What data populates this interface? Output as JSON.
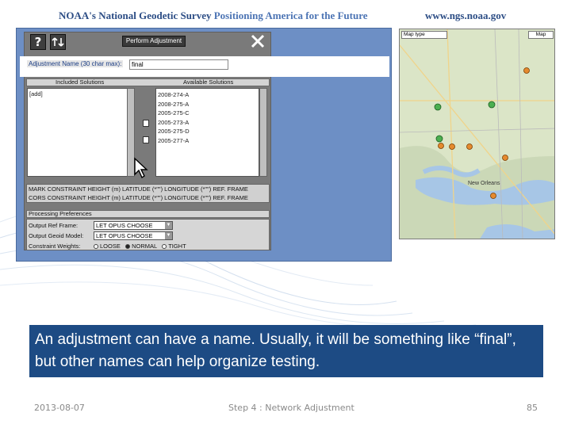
{
  "header": {
    "org_left": "NOAA's",
    "org_name": "National Geodetic Survey",
    "tagline": "Positioning America for the Future",
    "url": "www.ngs.noaa.gov"
  },
  "toolbar": {
    "help_icon": "?",
    "perform_label": "Perform Adjustment"
  },
  "adjustment_name": {
    "label": "Adjustment Name (30 char max):",
    "value": "final"
  },
  "solutions": {
    "included_header": "Included Solutions",
    "available_header": "Available Solutions",
    "included": [
      "[add]"
    ],
    "available": [
      "2008-274-A",
      "2008-275-A",
      "2005-275-C",
      "2005-273-A",
      "2005-275-D",
      "2005-277-A"
    ]
  },
  "constraints": {
    "row1": "MARK  CONSTRAINT  HEIGHT (m)  LATITUDE (*\"\")  LONGITUDE (*\"\")  REF. FRAME",
    "row2": "CORS  CONSTRAINT  HEIGHT (m)  LATITUDE (*\"\")  LONGITUDE (*\"\")  REF. FRAME"
  },
  "preferences": {
    "header": "Processing Preferences",
    "ref_frame_label": "Output Ref Frame:",
    "ref_frame_value": "LET OPUS CHOOSE",
    "geoid_label": "Output Geoid Model:",
    "geoid_value": "LET OPUS CHOOSE",
    "weights_label": "Constraint Weights:",
    "weights_options": [
      "LOOSE",
      "NORMAL",
      "TIGHT"
    ],
    "weights_selected": "NORMAL"
  },
  "map": {
    "type_label": "Map type",
    "map_button": "Map",
    "place_labels": [
      "New Orleans"
    ]
  },
  "caption": "An adjustment can have a name. Usually, it will be something like “final”, but other names can help organize testing.",
  "footer": {
    "date": "2013-08-07",
    "center": "Step 4 : Network Adjustment",
    "page": "85"
  },
  "colors": {
    "caption_bg": "#1d4b84",
    "window_frame": "#6d8fc5",
    "header_text": "#2c4d85"
  }
}
